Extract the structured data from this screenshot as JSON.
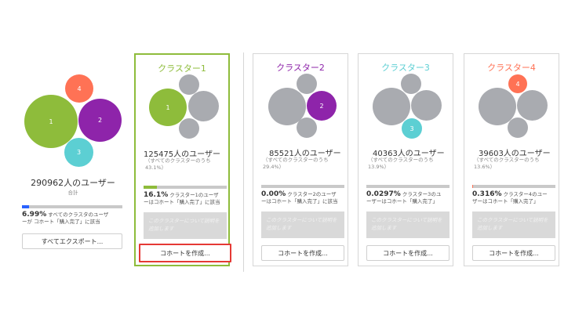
{
  "summary": {
    "count_label": "290962人のユーザー",
    "sub_label": "合計",
    "percent": "6.99%",
    "percent_text_line1": " すべてのクラスタのユーザ",
    "percent_text_line2": "ーが コホート「購入完了」に該当",
    "percent_fraction": 0.0699,
    "export_button": "すべてエクスポート...",
    "bubble_labels": [
      "1",
      "2",
      "3",
      "4"
    ]
  },
  "clusters": [
    {
      "title": "クラスター1",
      "color": "#8ebc3b",
      "selected": true,
      "count_label": "125475人のユーザー",
      "share_line1": "（すべてのクラスターのうち",
      "share_line2": "43.1%）",
      "percent": "16.1%",
      "percent_text_line1": " クラスター1のユーザ",
      "percent_text_line2": "ーはコホート「購入完了」に該当",
      "percent_fraction": 0.161,
      "description": "このクラスターについて説明を追加します",
      "create_button": "コホートを作成...",
      "bubble_label": "1"
    },
    {
      "title": "クラスター2",
      "color": "#8e24aa",
      "selected": false,
      "count_label": "85521人のユーザー",
      "share_line1": "（すべてのクラスターのうち",
      "share_line2": "29.4%）",
      "percent": "0.00%",
      "percent_text_line1": " クラスター2のユーザ",
      "percent_text_line2": "ーはコホート「購入完了」に該当",
      "percent_fraction": 0.0,
      "description": "このクラスターについて説明を追加します",
      "create_button": "コホートを作成...",
      "bubble_label": "2"
    },
    {
      "title": "クラスター3",
      "color": "#5ccfd3",
      "selected": false,
      "count_label": "40363人のユーザー",
      "share_line1": "（すべてのクラスターのうち",
      "share_line2": "13.9%）",
      "percent": "0.0297%",
      "percent_text_line1": " クラスター3のユ",
      "percent_text_line2": "ーザーはコホート「購入完了」",
      "percent_fraction": 0.000297,
      "description": "このクラスターについて説明を追加します",
      "create_button": "コホートを作成...",
      "bubble_label": "3"
    },
    {
      "title": "クラスター4",
      "color": "#ff7255",
      "selected": false,
      "count_label": "39603人のユーザー",
      "share_line1": "（すべてのクラスターのうち",
      "share_line2": "13.6%）",
      "percent": "0.316%",
      "percent_text_line1": " クラスター4のユー",
      "percent_text_line2": "ザーはコホート「購入完了」",
      "percent_fraction": 0.00316,
      "description": "このクラスターについて説明を追加します",
      "create_button": "コホートを作成...",
      "bubble_label": "4"
    }
  ],
  "colors": {
    "inactive_bubble": "#a9abb0",
    "bar_track": "#c9c9c9",
    "summary_bar": "#2962ff",
    "highlight": "#e53935"
  }
}
